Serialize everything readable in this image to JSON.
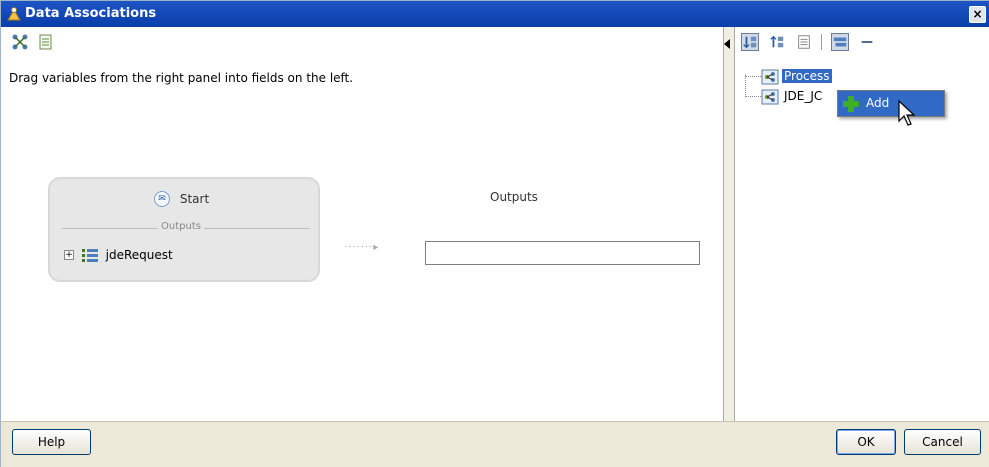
{
  "window": {
    "title": "Data Associations",
    "close_glyph": "×"
  },
  "left": {
    "instruction": "Drag variables from the right panel into fields on the left.",
    "toolbar_icons": [
      "mapper-icon",
      "xpath-document-icon"
    ],
    "source_card": {
      "title": "Start",
      "section_label": "Outputs",
      "expander_glyph": "+",
      "variable": "jdeRequest"
    },
    "arrow_glyph": "·······▸",
    "outputs_heading": "Outputs",
    "output_field_value": ""
  },
  "right": {
    "toolbar_icons": [
      "sort-ascending-icon",
      "sort-descending-icon",
      "list-view-icon",
      "tree-view-icon",
      "collapse-icon"
    ],
    "tree": [
      {
        "label": "Process",
        "selected": true
      },
      {
        "label": "JDE_JC",
        "selected": false
      }
    ],
    "context_menu": {
      "items": [
        {
          "label": "Add",
          "icon": "plus-icon"
        }
      ]
    }
  },
  "footer": {
    "help_label": "Help",
    "ok_label": "OK",
    "cancel_label": "Cancel"
  },
  "colors": {
    "title_bar": "#0a3ea8",
    "selection": "#316ac5",
    "footer_bg": "#ece9d8",
    "card_bg": "#e7e7e7"
  }
}
